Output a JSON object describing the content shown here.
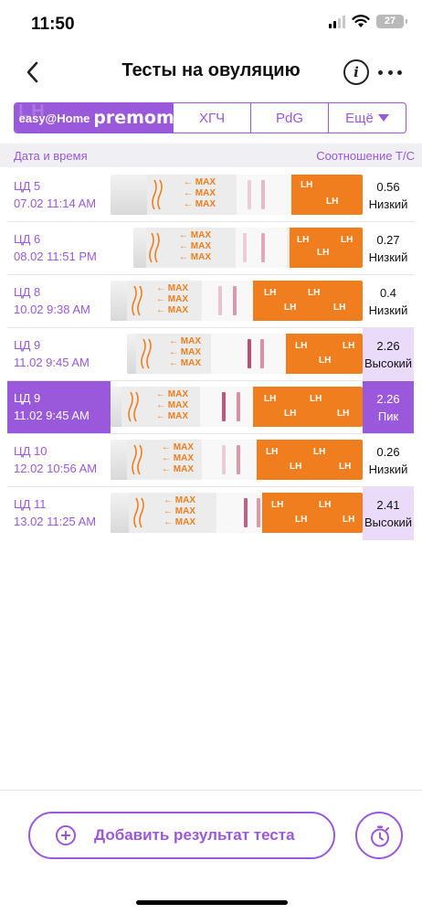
{
  "status_bar": {
    "time": "11:50",
    "battery": "27"
  },
  "header": {
    "title": "Тесты на овуляцию"
  },
  "brand_tabs": [
    {
      "label": "easy@Home",
      "watermark": "LH"
    },
    {
      "label": "premom"
    },
    {
      "label": "ХГЧ"
    },
    {
      "label": "PdG"
    },
    {
      "label": "Ещё"
    }
  ],
  "table_header": {
    "date": "Дата и время",
    "ratio": "Соотношение Т/С"
  },
  "rows": [
    {
      "cycle_day": "ЦД 5",
      "datetime": "07.02 11:14 AM",
      "ratio": "0.56",
      "level": "Низкий"
    },
    {
      "cycle_day": "ЦД 6",
      "datetime": "08.02 11:51 PM",
      "ratio": "0.27",
      "level": "Низкий"
    },
    {
      "cycle_day": "ЦД 8",
      "datetime": "10.02 9:38 AM",
      "ratio": "0.4",
      "level": "Низкий"
    },
    {
      "cycle_day": "ЦД 9",
      "datetime": "11.02 9:45 AM",
      "ratio": "2.26",
      "level": "Высокий"
    },
    {
      "cycle_day": "ЦД 9",
      "datetime": "11.02 9:45 AM",
      "ratio": "2.26",
      "level": "Пик"
    },
    {
      "cycle_day": "ЦД 10",
      "datetime": "12.02 10:56 AM",
      "ratio": "0.26",
      "level": "Низкий"
    },
    {
      "cycle_day": "ЦД 11",
      "datetime": "13.02 11:25 AM",
      "ratio": "2.41",
      "level": "Высокий"
    }
  ],
  "strip_text": {
    "max": "MAX",
    "lh": "LH"
  },
  "bottom": {
    "add_label": "Добавить результат теста"
  },
  "colors": {
    "accent": "#9a58db",
    "highlight": "#eadbfa",
    "strip_orange": "#f07e1f"
  }
}
